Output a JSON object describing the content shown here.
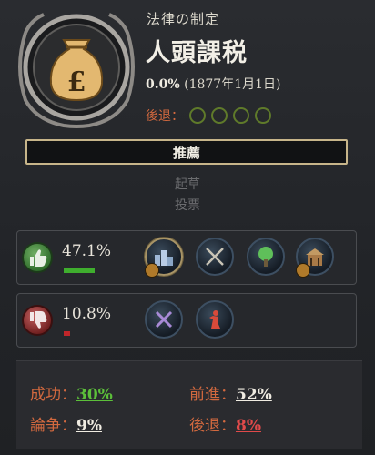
{
  "law": {
    "category": "法律の制定",
    "name": "人頭課税",
    "support_percent": "0.0%",
    "date": "(1877年1月1日)",
    "regress_label": "後退：",
    "regress_circles": 4,
    "icon": "money-bag-pound-icon"
  },
  "stages": {
    "active": "推薦",
    "next1": "起草",
    "next2": "投票"
  },
  "supporters": {
    "percent": "47.1%",
    "bar_fraction": 0.35,
    "color": "#3fae2e",
    "groups": [
      "industrialists-icon",
      "armed-forces-icon",
      "rural-folk-icon",
      "landowners-icon"
    ]
  },
  "opposers": {
    "percent": "10.8%",
    "bar_fraction": 0.08,
    "color": "#c0262a",
    "groups": [
      "trade-unions-icon",
      "petite-bourgeoisie-icon"
    ]
  },
  "stats": {
    "success_label": "成功：",
    "success_value": "30%",
    "advance_label": "前進：",
    "advance_value": "52%",
    "debate_label": "論争：",
    "debate_value": "9%",
    "regress_label": "後退：",
    "regress_value": "8%"
  },
  "colors": {
    "accent_orange": "#d2693f",
    "positive": "#5cbf3a",
    "negative": "#e04a4a",
    "frame_gold": "#c7b58a"
  }
}
